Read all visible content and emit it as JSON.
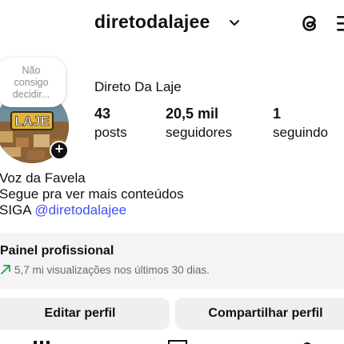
{
  "header": {
    "username": "diretodalajee",
    "icons": [
      "chevron-down-icon",
      "threads-icon",
      "menu-icon"
    ]
  },
  "profile": {
    "note_lines": [
      "Não",
      "consigo",
      "decidir..."
    ],
    "avatar_text": "LAJE",
    "display_name": "Direto Da Laje",
    "stats": [
      {
        "value": "43",
        "label": "posts"
      },
      {
        "value": "20,5 mil",
        "label": "seguidores"
      },
      {
        "value": "1",
        "label": "seguindo"
      }
    ]
  },
  "bio": {
    "lines": [
      "Voz da Favela",
      "Segue pra ver mais conteúdos"
    ],
    "siga_prefix": "SIGA ",
    "mention": "@diretodalajee"
  },
  "professional_panel": {
    "title": "Painel profissional",
    "subtitle": "5,7 mi visualizações nos últimos 30 dias.",
    "accent": "#1aa34a"
  },
  "actions": {
    "edit_label": "Editar perfil",
    "share_label": "Compartilhar perfil"
  },
  "colors": {
    "link": "#4150f7",
    "button_bg": "#efeff1",
    "panel_bg": "#f4f4f6"
  }
}
